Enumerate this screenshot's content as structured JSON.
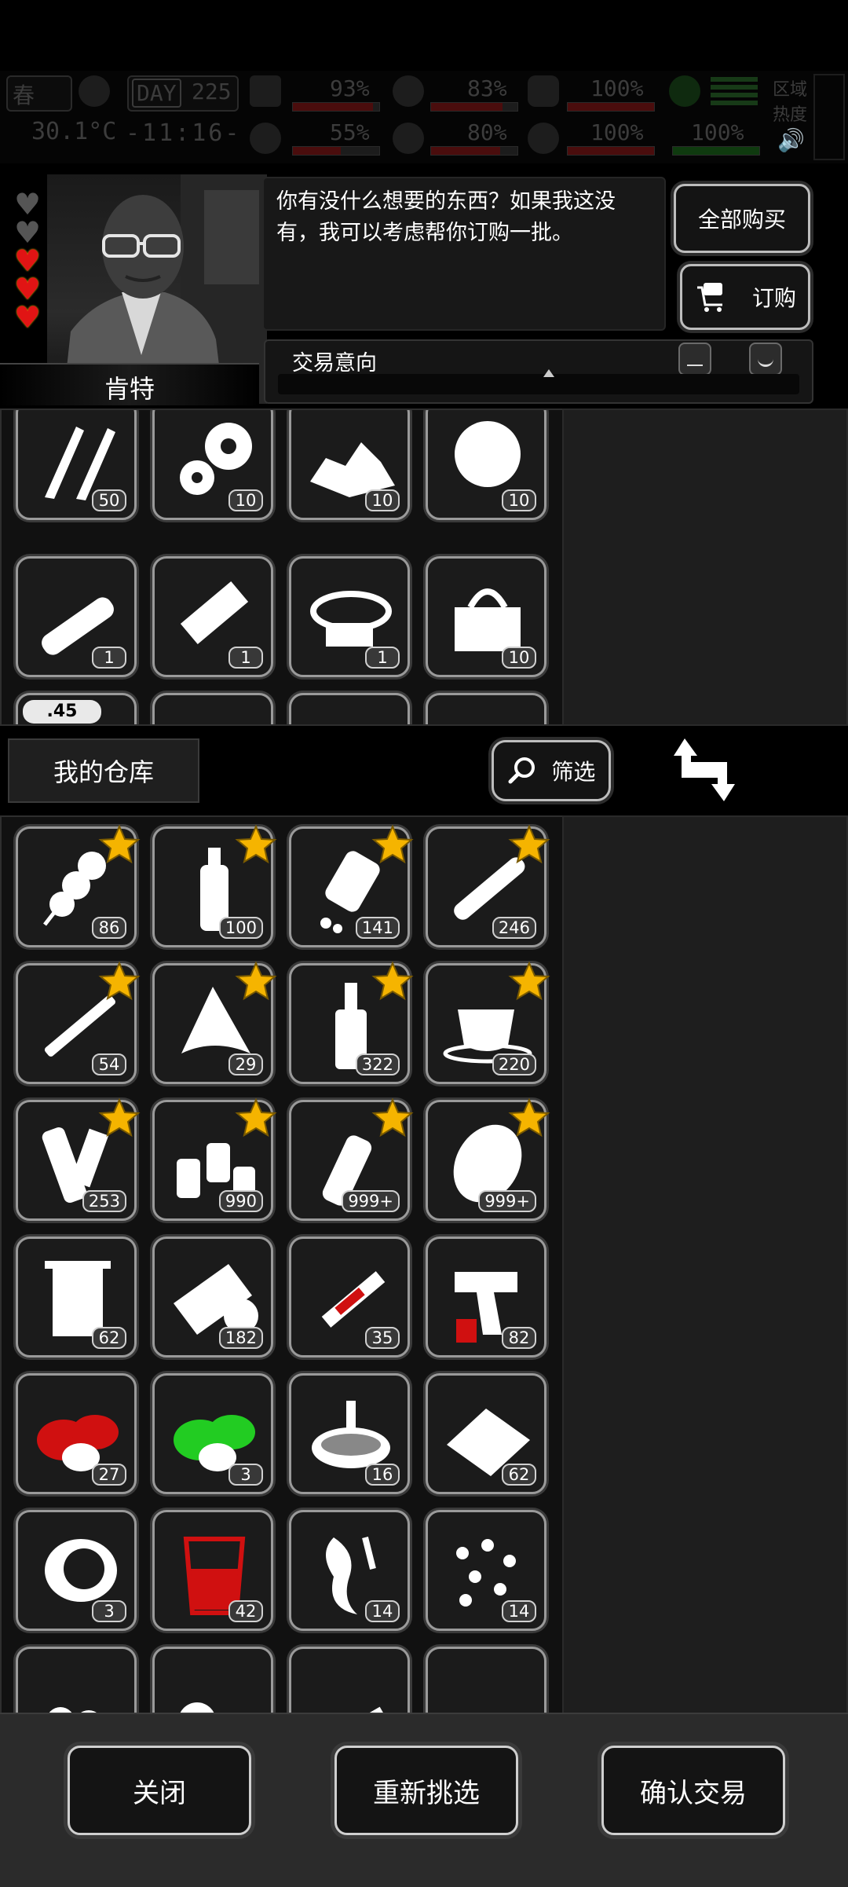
{
  "hud": {
    "season": "春",
    "day_label": "DAY",
    "day_number": "225",
    "temperature": "30.1°C",
    "clock": "-11:16-",
    "stats": [
      {
        "value": "93%",
        "level": 0.93,
        "icon": "medkit-icon"
      },
      {
        "value": "83%",
        "level": 0.83,
        "icon": "stomach-icon"
      },
      {
        "value": "100%",
        "level": 1.0,
        "icon": "bladder-icon"
      },
      {
        "value": "55%",
        "level": 0.55,
        "icon": "brain-icon"
      },
      {
        "value": "80%",
        "level": 0.8,
        "icon": "water-drop-icon"
      },
      {
        "value": "100%",
        "level": 1.0,
        "icon": "heart-icon"
      },
      {
        "value": "100%",
        "level": 1.0,
        "icon": "running-icon"
      }
    ],
    "area_label_1": "区域",
    "area_label_2": "热度"
  },
  "npc": {
    "name": "肯特",
    "hearts_total": 5,
    "hearts_filled": 3,
    "dialog": "你有没什么想要的东西？如果我这没有，我可以考虑帮你订购一批。",
    "buy_all_label": "全部购买",
    "order_label": "订购",
    "trade_intent_label": "交易意向",
    "trade_intent_level": 0.52
  },
  "merchant_items": [
    {
      "icon": "screws-icon",
      "count": "50"
    },
    {
      "icon": "gears-icon",
      "count": "10"
    },
    {
      "icon": "crushed-stone-icon",
      "count": "10"
    },
    {
      "icon": "cotton-icon",
      "count": "10"
    },
    {
      "icon": "rifle-scope-icon",
      "count": "1"
    },
    {
      "icon": "suppressor-kit-icon",
      "count": "1"
    },
    {
      "icon": "ammo-belt-icon",
      "count": "1"
    },
    {
      "icon": "tool-bag-icon",
      "count": "10"
    },
    {
      "icon": "ammo-45-icon",
      "tag": ".45"
    },
    {
      "icon": "barrel-icon"
    },
    {
      "icon": "jerrycan-icon"
    },
    {
      "icon": "mesh-ball-icon"
    }
  ],
  "warehouse_label": "我的仓库",
  "filter_label": "筛选",
  "warehouse_items": [
    {
      "icon": "potato-skewer-icon",
      "count": "86",
      "starred": true
    },
    {
      "icon": "water-bottle-icon",
      "count": "100",
      "starred": true
    },
    {
      "icon": "pills-bottle-icon",
      "count": "141",
      "starred": true
    },
    {
      "icon": "cigar-icon",
      "count": "246",
      "starred": true
    },
    {
      "icon": "cigarette-icon",
      "count": "54",
      "starred": true
    },
    {
      "icon": "torn-cloth-icon",
      "count": "29",
      "starred": true
    },
    {
      "icon": "liquor-bottle-icon",
      "count": "322",
      "starred": true
    },
    {
      "icon": "coffee-cup-icon",
      "count": "220",
      "starred": true
    },
    {
      "icon": "cloth-roll-icon",
      "count": "253",
      "starred": true
    },
    {
      "icon": "spice-bottles-icon",
      "count": "990",
      "starred": true
    },
    {
      "icon": "glass-bottle-icon",
      "count": "999+",
      "starred": true
    },
    {
      "icon": "potato-icon",
      "count": "999+",
      "starred": true
    },
    {
      "icon": "towel-icon",
      "count": "62"
    },
    {
      "icon": "bandage-roll-icon",
      "count": "182"
    },
    {
      "icon": "syringe-icon",
      "count": "35"
    },
    {
      "icon": "flare-gun-icon",
      "count": "82"
    },
    {
      "icon": "red-herb-icon",
      "count": "27"
    },
    {
      "icon": "green-herb-icon",
      "count": "3"
    },
    {
      "icon": "soup-bowl-icon",
      "count": "16"
    },
    {
      "icon": "scrap-tray-icon",
      "count": "62"
    },
    {
      "icon": "gas-mask-filter-icon",
      "count": "3"
    },
    {
      "icon": "blood-cup-icon",
      "count": "42"
    },
    {
      "icon": "ginseng-root-icon",
      "count": "14"
    },
    {
      "icon": "seeds-icon",
      "count": "14"
    },
    {
      "icon": "nuts-icon"
    },
    {
      "icon": "tablets-icon"
    },
    {
      "icon": "ointment-tube-icon"
    },
    {
      "icon": "capsules-icon"
    }
  ],
  "footer": {
    "close_label": "关闭",
    "reselect_label": "重新挑选",
    "confirm_label": "确认交易"
  },
  "colors": {
    "background": "#000000",
    "panel": "#111111",
    "slot_border": "#9a9a9a",
    "heart_red": "#e11414",
    "star_gold": "#f5b400"
  }
}
